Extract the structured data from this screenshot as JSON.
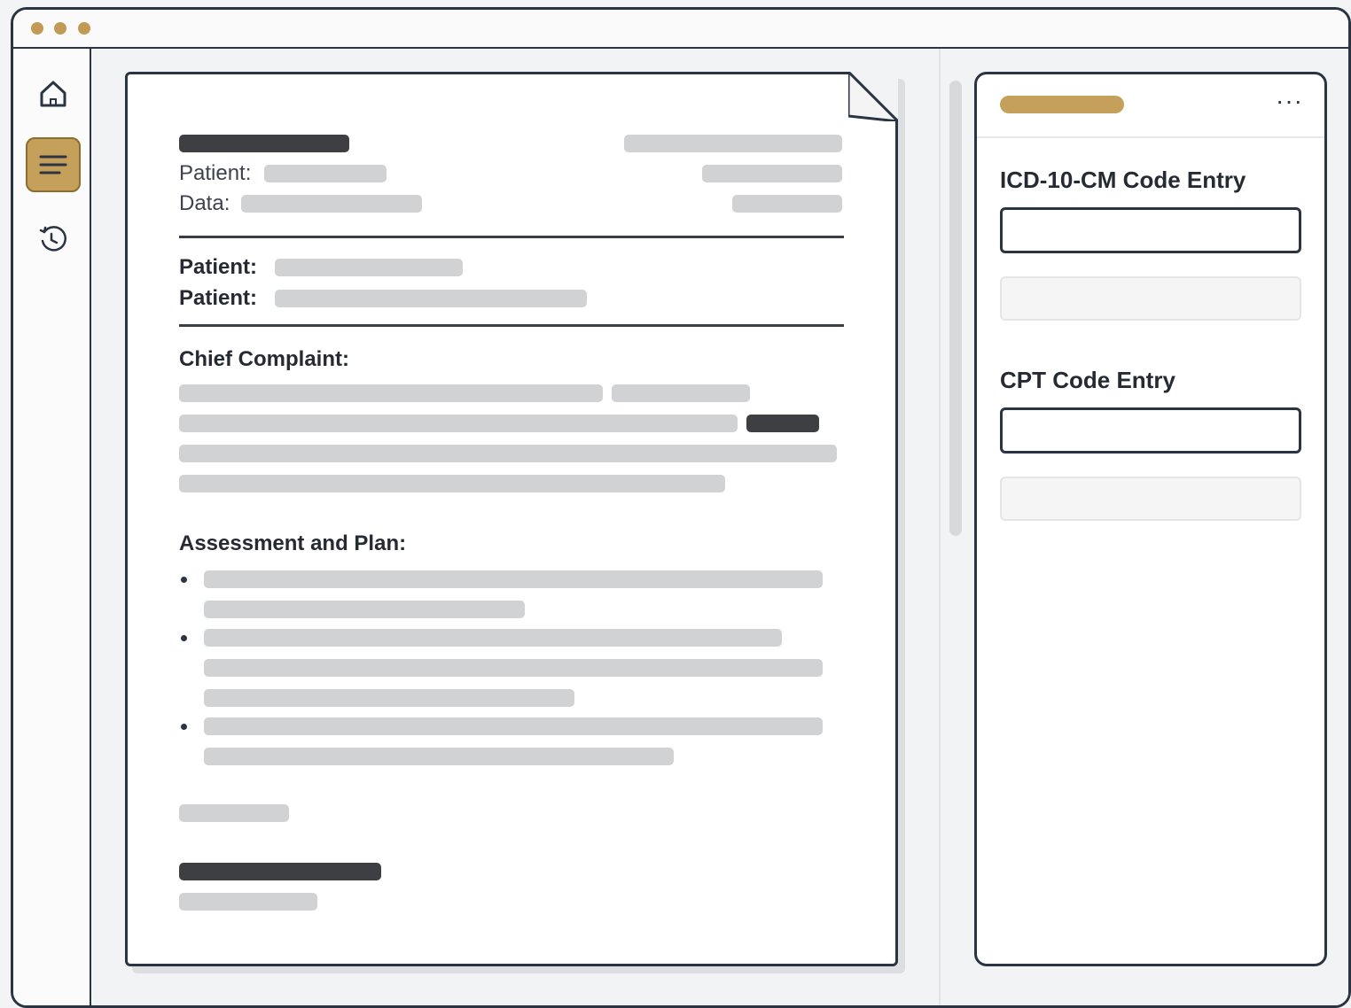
{
  "sidebar": {
    "items": [
      {
        "icon": "home-icon",
        "active": false
      },
      {
        "icon": "document-lines-icon",
        "active": true
      },
      {
        "icon": "history-icon",
        "active": false
      }
    ]
  },
  "document": {
    "header_fields": [
      {
        "label": "Patient:"
      },
      {
        "label": "Data:"
      }
    ],
    "patient_fields": [
      {
        "label": "Patient:"
      },
      {
        "label": "Patient:"
      }
    ],
    "chief_complaint_heading": "Chief Complaint:",
    "assessment_heading": "Assessment and Plan:"
  },
  "coding_panel": {
    "menu_label": "···",
    "icd_section": {
      "title": "ICD-10-CM Code Entry",
      "value": ""
    },
    "cpt_section": {
      "title": "CPT Code Entry",
      "value": ""
    }
  },
  "colors": {
    "accent": "#c4a05a",
    "outline": "#2b3442",
    "placeholder_bar": "#d1d2d4",
    "redacted_dark": "#3d3f43"
  }
}
